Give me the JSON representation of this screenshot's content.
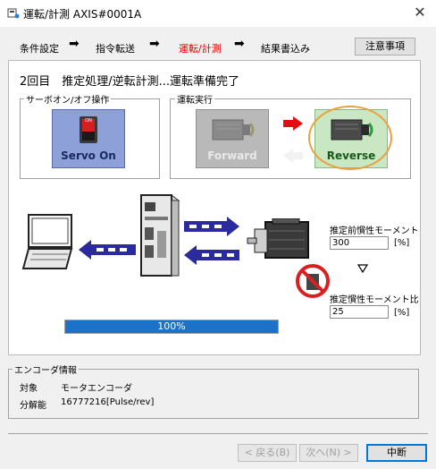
{
  "window": {
    "title": "運転/計測 AXIS#0001A",
    "close_symbol": "✕"
  },
  "steps": [
    {
      "label": "条件設定",
      "state": "done"
    },
    {
      "label": "指令転送",
      "state": "done"
    },
    {
      "label": "運転/計測",
      "state": "active"
    },
    {
      "label": "結果書込み",
      "state": "pending"
    }
  ],
  "step_arrow": "➡",
  "notes_button": "注意事項",
  "status_text": "2回目　推定処理/逆転計測...運転準備完了",
  "servo_group": {
    "title": "サーボオン/オフ操作",
    "button_label": "Servo On",
    "switch_label": "ON"
  },
  "run_group": {
    "title": "運転実行",
    "forward_label": "Forward",
    "reverse_label": "Reverse",
    "selected": "Reverse"
  },
  "diagram": {
    "icons": [
      "laptop-icon",
      "servo-pack-icon",
      "motor-icon",
      "no-load-icon"
    ]
  },
  "moment": {
    "before_label": "推定前慣性モーメント",
    "before_value": "300",
    "before_unit": "[%]",
    "after_label": "推定慣性モーメント比",
    "after_value": "25",
    "after_unit": "[%]"
  },
  "progress": {
    "fraction": 1.0,
    "text": "100%"
  },
  "encoder": {
    "title": "エンコーダ情報",
    "rows": [
      {
        "label": "対象",
        "value": "モータエンコーダ"
      },
      {
        "label": "分解能",
        "value": "16777216[Pulse/rev]"
      }
    ]
  },
  "footer": {
    "back_label": "< 戻る(B)",
    "next_label": "次へ(N) >",
    "cancel_label": "中断"
  },
  "colors": {
    "accent": "#0078d7",
    "active_step": "#e00000",
    "progress": "#1c72c6",
    "arrow_blue": "#2b2b9e",
    "arrow_red": "#e01010",
    "highlight_ring": "#e8a040"
  }
}
